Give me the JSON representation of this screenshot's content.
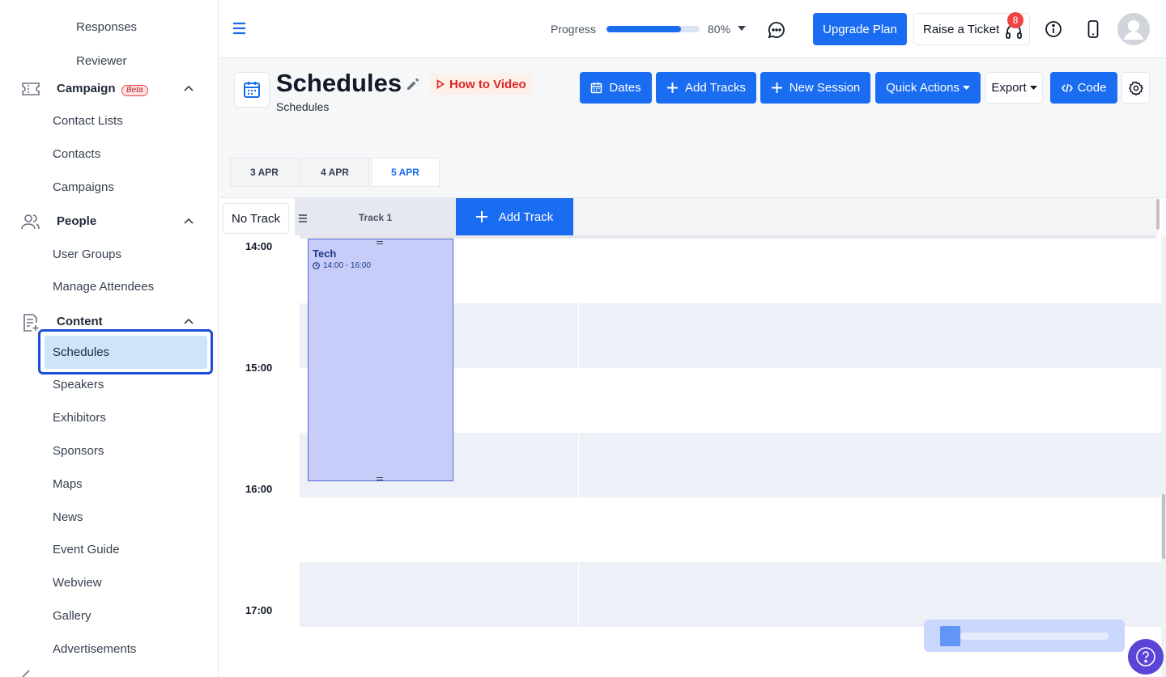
{
  "sidebar": {
    "top_items": [
      "Responses",
      "Reviewer"
    ],
    "campaign": {
      "label": "Campaign",
      "badge": "Beta",
      "items": [
        "Contact Lists",
        "Contacts",
        "Campaigns"
      ]
    },
    "people": {
      "label": "People",
      "items": [
        "User Groups",
        "Manage Attendees"
      ]
    },
    "content": {
      "label": "Content",
      "items": [
        "Schedules",
        "Speakers",
        "Exhibitors",
        "Sponsors",
        "Maps",
        "News",
        "Event Guide",
        "Webview",
        "Gallery",
        "Advertisements"
      ]
    }
  },
  "topbar": {
    "progress_label": "Progress",
    "progress_value": 80,
    "progress_text": "80%",
    "upgrade_label": "Upgrade Plan",
    "ticket_label": "Raise a Ticket",
    "notification_count": "8"
  },
  "page": {
    "title": "Schedules",
    "subtitle": "Schedules",
    "how_to_label": "How to Video"
  },
  "toolbar": {
    "dates_label": "Dates",
    "add_tracks_label": "Add Tracks",
    "new_session_label": "New Session",
    "quick_actions_label": "Quick Actions",
    "export_label": "Export",
    "code_label": "Code"
  },
  "date_tabs": [
    "3 APR",
    "4 APR",
    "5 APR"
  ],
  "selected_date": "5 APR",
  "tracks": {
    "no_track_label": "No Track",
    "track1_label": "Track 1",
    "add_track_label": "Add Track"
  },
  "hours": [
    "14:00",
    "15:00",
    "16:00",
    "17:00"
  ],
  "session": {
    "title": "Tech",
    "time": "14:00 - 16:00"
  },
  "colors": {
    "primary": "#1a6cf0",
    "selected": "#cde4fb",
    "session": "#c7cdf8",
    "badge": "#ef4444"
  }
}
